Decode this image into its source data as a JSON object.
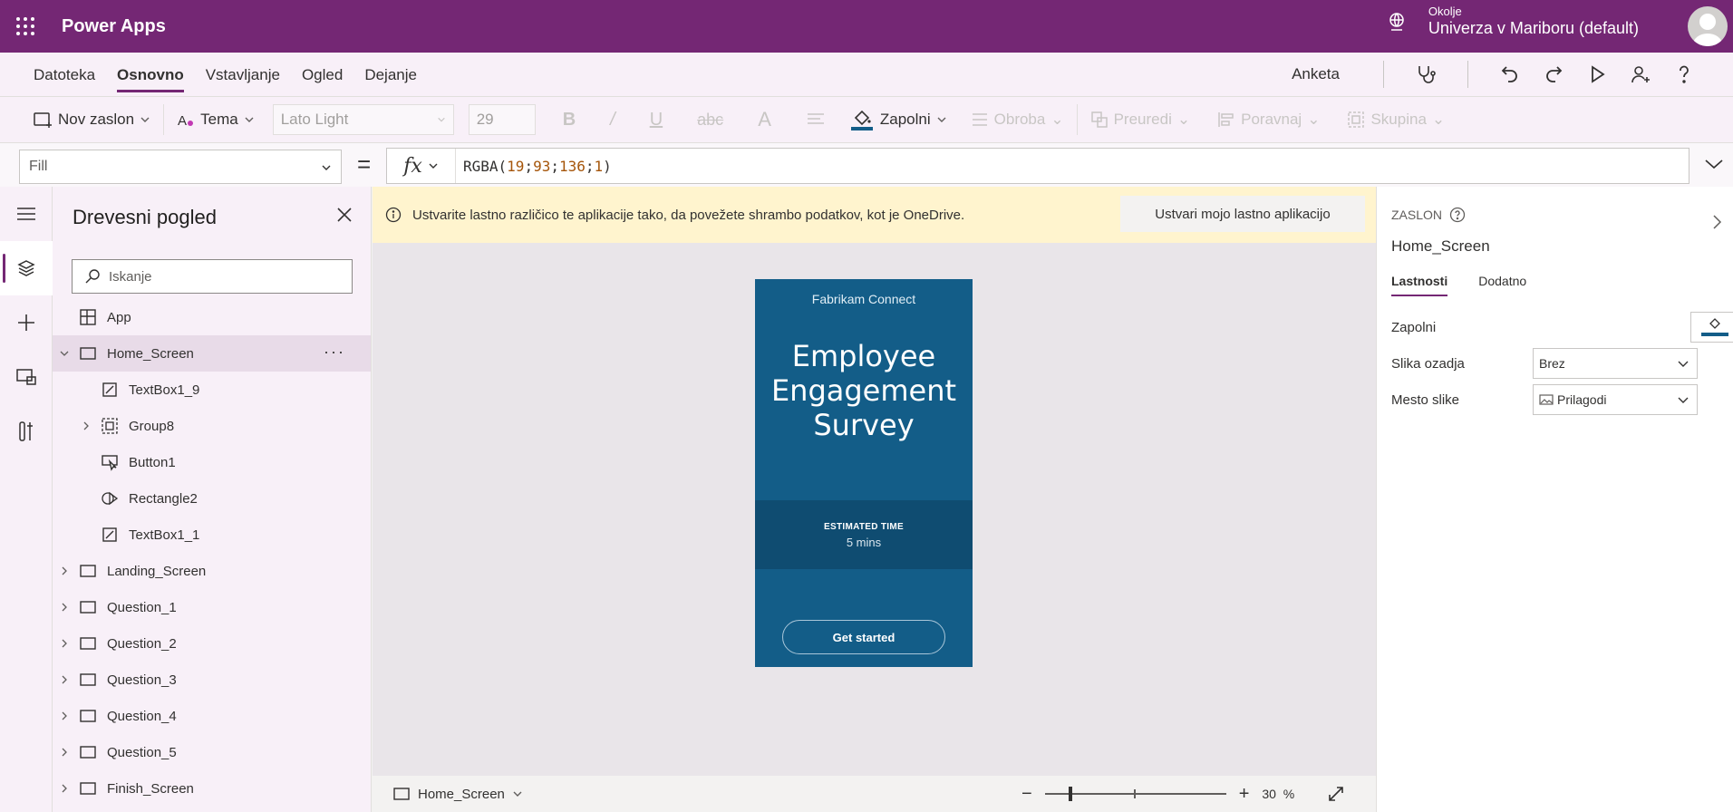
{
  "app": {
    "name": "Power Apps"
  },
  "environment": {
    "label": "Okolje",
    "name": "Univerza v Mariboru (default)"
  },
  "menu": {
    "items": [
      "Datoteka",
      "Osnovno",
      "Vstavljanje",
      "Ogled",
      "Dejanje"
    ],
    "active": "Osnovno",
    "right_label": "Anketa"
  },
  "toolbar": {
    "new_screen": "Nov zaslon",
    "theme": "Tema",
    "font": "Lato Light",
    "font_size": "29",
    "fill": "Zapolni",
    "border": "Obroba",
    "reorder": "Preuredi",
    "align": "Poravnaj",
    "group": "Skupina"
  },
  "formula": {
    "property": "Fill",
    "equals": "=",
    "fx": "fx",
    "fn": "RGBA",
    "args": [
      "19",
      "93",
      "136",
      "1"
    ]
  },
  "tree": {
    "title": "Drevesni pogled",
    "search_placeholder": "Iskanje",
    "app_label": "App",
    "items": [
      {
        "label": "Home_Screen"
      },
      {
        "label": "TextBox1_9"
      },
      {
        "label": "Group8"
      },
      {
        "label": "Button1"
      },
      {
        "label": "Rectangle2"
      },
      {
        "label": "TextBox1_1"
      },
      {
        "label": "Landing_Screen"
      },
      {
        "label": "Question_1"
      },
      {
        "label": "Question_2"
      },
      {
        "label": "Question_3"
      },
      {
        "label": "Question_4"
      },
      {
        "label": "Question_5"
      },
      {
        "label": "Finish_Screen"
      }
    ]
  },
  "banner": {
    "text": "Ustvarite lastno različico te aplikacije tako, da povežete shrambo podatkov, kot je OneDrive.",
    "button": "Ustvari mojo lastno aplikacijo"
  },
  "preview": {
    "brand": "Fabrikam Connect",
    "title_lines": [
      "Employee",
      "Engagement",
      "Survey"
    ],
    "estimated_label": "ESTIMATED TIME",
    "estimated_value": "5 mins",
    "button": "Get started",
    "fill_color": "#135d88"
  },
  "canvas_bottom": {
    "screen": "Home_Screen",
    "zoom": "30",
    "zoom_unit": "%",
    "zoom_level": 0.3
  },
  "properties": {
    "kind": "ZASLON",
    "name": "Home_Screen",
    "tabs": [
      "Lastnosti",
      "Dodatno"
    ],
    "rows": [
      {
        "label": "Zapolni",
        "value": ""
      },
      {
        "label": "Slika ozadja",
        "value": "Brez"
      },
      {
        "label": "Mesto slike",
        "value": "Prilagodi"
      }
    ]
  },
  "colors": {
    "brand": "#742774",
    "preview": "#135d88",
    "banner": "#fff4ce"
  }
}
